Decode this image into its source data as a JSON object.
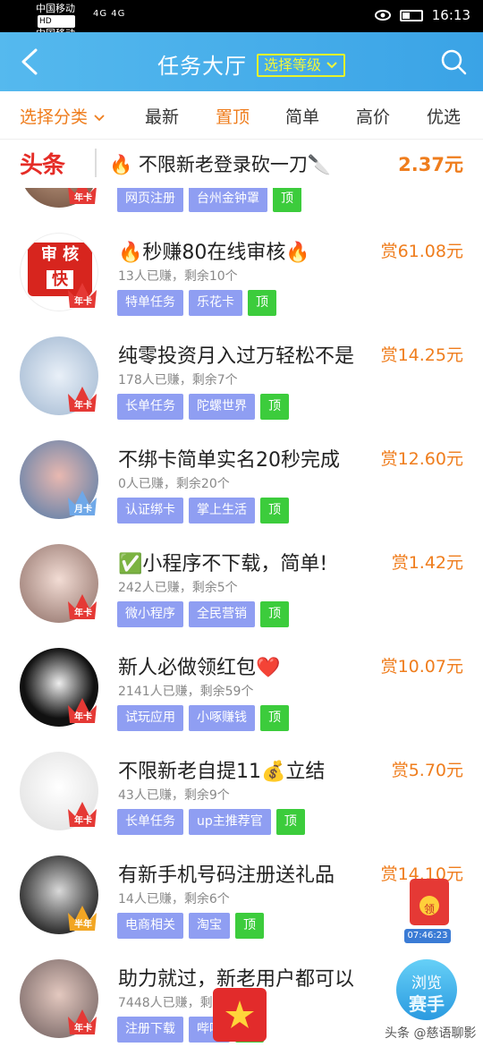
{
  "status_bar": {
    "carrier1": "中国移动",
    "carrier2": "中国移动",
    "hd": "HD",
    "signal": "4G 4G",
    "time": "16:13"
  },
  "header": {
    "title": "任务大厅",
    "level_select": "选择等级"
  },
  "tabs": [
    "选择分类",
    "最新",
    "置顶",
    "简单",
    "高价",
    "优选"
  ],
  "banner": {
    "brand": "头条",
    "text": "🔥 不限新老登录砍一刀🔪",
    "price": "2.37元"
  },
  "partial_item": {
    "tags": [
      "网页注册",
      "台州金钟罩",
      "顶"
    ],
    "badge": "年卡"
  },
  "items": [
    {
      "title": "🔥秒赚80在线审核🔥",
      "sub": "13人已赚，剩余10个",
      "price": "赏61.08元",
      "tags": [
        "特单任务",
        "乐花卡",
        "顶"
      ],
      "badge": "年卡",
      "avatar_text": "审核快"
    },
    {
      "title": "纯零投资月入过万轻松不是",
      "sub": "178人已赚，剩余7个",
      "price": "赏14.25元",
      "tags": [
        "长单任务",
        "陀螺世界",
        "顶"
      ],
      "badge": "年卡"
    },
    {
      "title": "不绑卡简单实名20秒完成",
      "sub": "0人已赚，剩余20个",
      "price": "赏12.60元",
      "tags": [
        "认证绑卡",
        "掌上生活",
        "顶"
      ],
      "badge": "月卡"
    },
    {
      "title": "✅小程序不下载，简单!",
      "sub": "242人已赚，剩余5个",
      "price": "赏1.42元",
      "tags": [
        "微小程序",
        "全民营销",
        "顶"
      ],
      "badge": "年卡"
    },
    {
      "title": "新人必做领红包❤️",
      "sub": "2141人已赚，剩余59个",
      "price": "赏10.07元",
      "tags": [
        "试玩应用",
        "小啄赚钱",
        "顶"
      ],
      "badge": "年卡"
    },
    {
      "title": "不限新老自提11💰立结",
      "sub": "43人已赚，剩余9个",
      "price": "赏5.70元",
      "tags": [
        "长单任务",
        "up主推荐官",
        "顶"
      ],
      "badge": "年卡"
    },
    {
      "title": "有新手机号码注册送礼品",
      "sub": "14人已赚，剩余6个",
      "price": "赏14.10元",
      "tags": [
        "电商相关",
        "淘宝",
        "顶"
      ],
      "badge": "半年"
    },
    {
      "title": "助力就过，新老用户都可以",
      "sub": "7448人已赚，剩",
      "price": "",
      "tags": [
        "注册下载",
        "哔哩",
        "顶"
      ],
      "badge": "年卡"
    }
  ],
  "float": {
    "timer": "07:46:23",
    "red_label": "领",
    "browse_top": "浏览",
    "browse_bottom": "赛手"
  },
  "watermark": "头条 @慈语聊影",
  "colors": {
    "accent": "#ef7d1d",
    "header": "#4aaeea",
    "tag": "#8f9ef2",
    "top_tag": "#3ccc3c"
  }
}
